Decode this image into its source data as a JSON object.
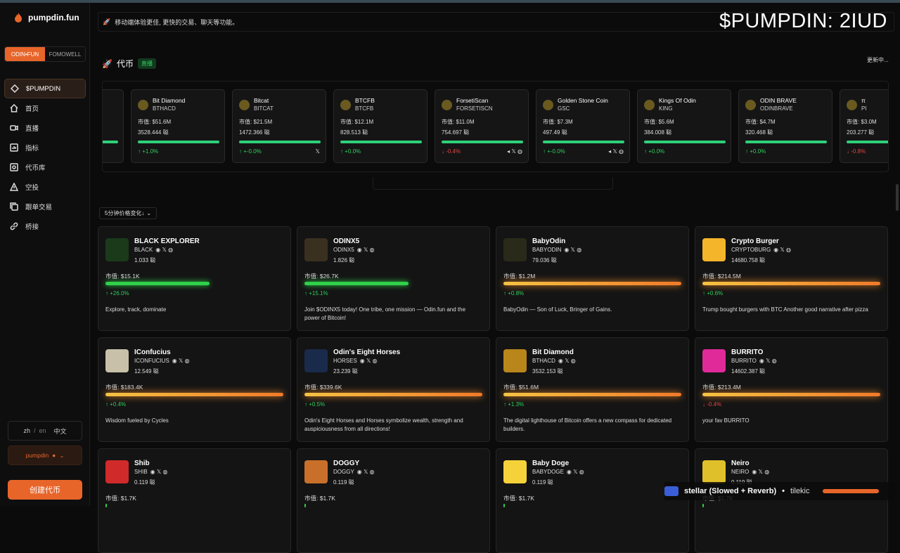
{
  "app": {
    "name": "pumpdin.fun"
  },
  "segments": [
    "ODIN•FUN",
    "FOMOWELL"
  ],
  "nav": [
    {
      "label": "$PUMPDIN",
      "icon": "diamond-icon"
    },
    {
      "label": "首页",
      "icon": "home-icon"
    },
    {
      "label": "直播",
      "icon": "video-icon"
    },
    {
      "label": "指标",
      "icon": "chart-icon"
    },
    {
      "label": "代币库",
      "icon": "library-icon"
    },
    {
      "label": "空投",
      "icon": "warning-icon"
    },
    {
      "label": "跟单交易",
      "icon": "copy-icon"
    },
    {
      "label": "桥接",
      "icon": "link-icon"
    }
  ],
  "lang": {
    "zh": "zh",
    "sep": "/",
    "en": "en",
    "cn": "中文"
  },
  "user": {
    "label": "pumpdin"
  },
  "create_label": "创建代币",
  "banner": {
    "text": "移动端体验更佳, 更快的交易、聊天等功能。"
  },
  "overlay_text": "$PUMPDIN: 2IUD",
  "section": {
    "title": "代币",
    "live": "直播",
    "update": "更新中..."
  },
  "ticker": [
    {
      "name": "Bit Diamond",
      "ticker": "BTHACD",
      "mcap": "市值: $51.6M",
      "holders": "3528.444 聪",
      "change": "↑ +1.0%",
      "dir": "up",
      "socials": ""
    },
    {
      "name": "Bitcat",
      "ticker": "BITCAT",
      "mcap": "市值: $21.5M",
      "holders": "1472.366 聪",
      "change": "↑ +-0.0%",
      "dir": "up",
      "socials": "𝕏"
    },
    {
      "name": "BTCFB",
      "ticker": "BTCFB",
      "mcap": "市值: $12.1M",
      "holders": "828.513 聪",
      "change": "↑ +0.0%",
      "dir": "up",
      "socials": ""
    },
    {
      "name": "ForsetiScan",
      "ticker": "FORSETISCN",
      "mcap": "市值: $11.0M",
      "holders": "754.697 聪",
      "change": "↓ -0.4%",
      "dir": "down",
      "socials": "◂ 𝕏 ◍"
    },
    {
      "name": "Golden Stone Coin",
      "ticker": "GSC",
      "mcap": "市值: $7.3M",
      "holders": "497.49 聪",
      "change": "↑ +-0.0%",
      "dir": "up",
      "socials": "◂ 𝕏 ◍"
    },
    {
      "name": "Kings Of Odin",
      "ticker": "KING",
      "mcap": "市值: $5.6M",
      "holders": "384.008 聪",
      "change": "↑ +0.0%",
      "dir": "up",
      "socials": ""
    },
    {
      "name": "ODIN BRAVE",
      "ticker": "ODINBRAVE",
      "mcap": "市值: $4.7M",
      "holders": "320.468 聪",
      "change": "↑ +0.0%",
      "dir": "up",
      "socials": ""
    },
    {
      "name": "π",
      "ticker": "PI",
      "mcap": "市值: $3.0M",
      "holders": "203.277 聪",
      "change": "↓ -0.8%",
      "dir": "down",
      "socials": ""
    }
  ],
  "sort": {
    "label": "5分钟价格变化↓"
  },
  "cards": [
    {
      "name": "BLACK EXPLORER",
      "ticker": "BLACK",
      "holders": "1.033 聪",
      "mcap": "市值: $15.1K",
      "change": "↑ +26.0%",
      "dir": "up",
      "desc": "Explore, track, dominate",
      "bar": "g",
      "color": "#1a3a1a"
    },
    {
      "name": "ODINX5",
      "ticker": "ODINX5",
      "holders": "1.826 聪",
      "mcap": "市值: $26.7K",
      "change": "↑ +15.1%",
      "dir": "up",
      "desc": "Join $ODINX5 today! One tribe, one mission — Odin.fun and the power of Bitcoin!",
      "bar": "g",
      "color": "#3a3020"
    },
    {
      "name": "BabyOdin",
      "ticker": "BABYODIN",
      "holders": "79.036 聪",
      "mcap": "市值: $1.2M",
      "change": "↑ +0.8%",
      "dir": "up",
      "desc": "BabyOdin — Son of Luck, Bringer of Gains.",
      "bar": "o",
      "color": "#2a2a1a"
    },
    {
      "name": "Crypto Burger",
      "ticker": "CRYPTOBURG",
      "holders": "14680.758 聪",
      "mcap": "市值: $214.5M",
      "change": "↑ +0.6%",
      "dir": "up",
      "desc": "Trump bought burgers with BTC Another good narrative after pizza",
      "bar": "o",
      "color": "#f5b52a"
    },
    {
      "name": "IConfucius",
      "ticker": "ICONFUCIUS",
      "holders": "12.549 聪",
      "mcap": "市值: $183.4K",
      "change": "↑ +0.4%",
      "dir": "up",
      "desc": "Wisdom fueled by Cycles",
      "bar": "o",
      "color": "#c8c0a8"
    },
    {
      "name": "Odin's Eight Horses",
      "ticker": "HORSES",
      "holders": "23.239 聪",
      "mcap": "市值: $339.6K",
      "change": "↑ +0.5%",
      "dir": "up",
      "desc": "Odin's Eight Horses and Horses symbolize wealth, strength and auspiciousness from all directions!",
      "bar": "o",
      "color": "#1a2a4a"
    },
    {
      "name": "Bit Diamond",
      "ticker": "BTHACD",
      "holders": "3532.153 聪",
      "mcap": "市值: $51.6M",
      "change": "↑ +1.3%",
      "dir": "up",
      "desc": "The digital lighthouse of Bitcoin offers a new compass for dedicated builders.",
      "bar": "o",
      "color": "#b8861a"
    },
    {
      "name": "BURRITO",
      "ticker": "BURRITO",
      "holders": "14602.387 聪",
      "mcap": "市值: $213.4M",
      "change": "↓ -0.4%",
      "dir": "down",
      "desc": "your fav BURRITO",
      "bar": "o",
      "color": "#e02a9a"
    },
    {
      "name": "Shib",
      "ticker": "SHIB",
      "holders": "0.119 聪",
      "mcap": "市值: $1.7K",
      "change": "",
      "dir": "up",
      "desc": "",
      "bar": "",
      "color": "#d02a2a"
    },
    {
      "name": "DOGGY",
      "ticker": "DOGGY",
      "holders": "0.119 聪",
      "mcap": "市值: $1.7K",
      "change": "",
      "dir": "up",
      "desc": "",
      "bar": "",
      "color": "#c8702a"
    },
    {
      "name": "Baby Doge",
      "ticker": "BABYDOGE",
      "holders": "0.119 聪",
      "mcap": "市值: $1.7K",
      "change": "",
      "dir": "up",
      "desc": "",
      "bar": "",
      "color": "#f5d23a"
    },
    {
      "name": "Neiro",
      "ticker": "NEIRO",
      "holders": "0.119 聪",
      "mcap": "市值: $1.7K",
      "change": "",
      "dir": "up",
      "desc": "",
      "bar": "",
      "color": "#e0c02a"
    }
  ],
  "player": {
    "title": "stellar (Slowed + Reverb)",
    "sep": "•",
    "artist": "tilekic"
  }
}
